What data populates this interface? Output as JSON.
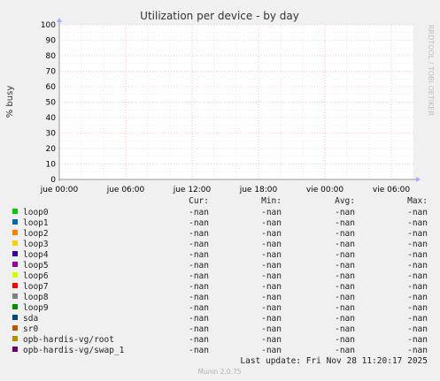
{
  "chart_data": {
    "type": "line",
    "title": "Utilization per device - by day",
    "ylabel": "% busy",
    "xlabel": "",
    "ylim": [
      0,
      100
    ],
    "yticks": [
      0,
      10,
      20,
      30,
      40,
      50,
      60,
      70,
      80,
      90,
      100
    ],
    "xticks": [
      "jue 00:00",
      "jue 06:00",
      "jue 12:00",
      "jue 18:00",
      "vie 00:00",
      "vie 06:00"
    ],
    "grid": true,
    "series": [
      {
        "name": "loop0",
        "color": "#00cc00",
        "values": []
      },
      {
        "name": "loop1",
        "color": "#0066b3",
        "values": []
      },
      {
        "name": "loop2",
        "color": "#ff8000",
        "values": []
      },
      {
        "name": "loop3",
        "color": "#ffcc00",
        "values": []
      },
      {
        "name": "loop4",
        "color": "#330099",
        "values": []
      },
      {
        "name": "loop5",
        "color": "#990099",
        "values": []
      },
      {
        "name": "loop6",
        "color": "#ccff00",
        "values": []
      },
      {
        "name": "loop7",
        "color": "#ff0000",
        "values": []
      },
      {
        "name": "loop8",
        "color": "#808080",
        "values": []
      },
      {
        "name": "loop9",
        "color": "#008f00",
        "values": []
      },
      {
        "name": "sda",
        "color": "#00487d",
        "values": []
      },
      {
        "name": "sr0",
        "color": "#b35a00",
        "values": []
      },
      {
        "name": "opb-hardis-vg/root",
        "color": "#b38f00",
        "values": []
      },
      {
        "name": "opb-hardis-vg/swap_1",
        "color": "#6b006b",
        "values": []
      }
    ]
  },
  "legend": {
    "headers": [
      "Cur:",
      "Min:",
      "Avg:",
      "Max:"
    ],
    "rows": [
      {
        "name": "loop0",
        "cur": "-nan",
        "min": "-nan",
        "avg": "-nan",
        "max": "-nan"
      },
      {
        "name": "loop1",
        "cur": "-nan",
        "min": "-nan",
        "avg": "-nan",
        "max": "-nan"
      },
      {
        "name": "loop2",
        "cur": "-nan",
        "min": "-nan",
        "avg": "-nan",
        "max": "-nan"
      },
      {
        "name": "loop3",
        "cur": "-nan",
        "min": "-nan",
        "avg": "-nan",
        "max": "-nan"
      },
      {
        "name": "loop4",
        "cur": "-nan",
        "min": "-nan",
        "avg": "-nan",
        "max": "-nan"
      },
      {
        "name": "loop5",
        "cur": "-nan",
        "min": "-nan",
        "avg": "-nan",
        "max": "-nan"
      },
      {
        "name": "loop6",
        "cur": "-nan",
        "min": "-nan",
        "avg": "-nan",
        "max": "-nan"
      },
      {
        "name": "loop7",
        "cur": "-nan",
        "min": "-nan",
        "avg": "-nan",
        "max": "-nan"
      },
      {
        "name": "loop8",
        "cur": "-nan",
        "min": "-nan",
        "avg": "-nan",
        "max": "-nan"
      },
      {
        "name": "loop9",
        "cur": "-nan",
        "min": "-nan",
        "avg": "-nan",
        "max": "-nan"
      },
      {
        "name": "sda",
        "cur": "-nan",
        "min": "-nan",
        "avg": "-nan",
        "max": "-nan"
      },
      {
        "name": "sr0",
        "cur": "-nan",
        "min": "-nan",
        "avg": "-nan",
        "max": "-nan"
      },
      {
        "name": "opb-hardis-vg/root",
        "cur": "-nan",
        "min": "-nan",
        "avg": "-nan",
        "max": "-nan"
      },
      {
        "name": "opb-hardis-vg/swap_1",
        "cur": "-nan",
        "min": "-nan",
        "avg": "-nan",
        "max": "-nan"
      }
    ]
  },
  "last_update": "Last update: Fri Nov 28 11:20:17 2025",
  "watermark": "RRDTOOL / TOBI OETIKER",
  "footer": "Munin 2.0.75",
  "colors": {
    "background": "#f0f0f0",
    "plot_background": "#ffffff",
    "grid_major": "#ff9999",
    "grid_minor": "#dddddd",
    "axis": "#999999",
    "title": "#333333"
  }
}
